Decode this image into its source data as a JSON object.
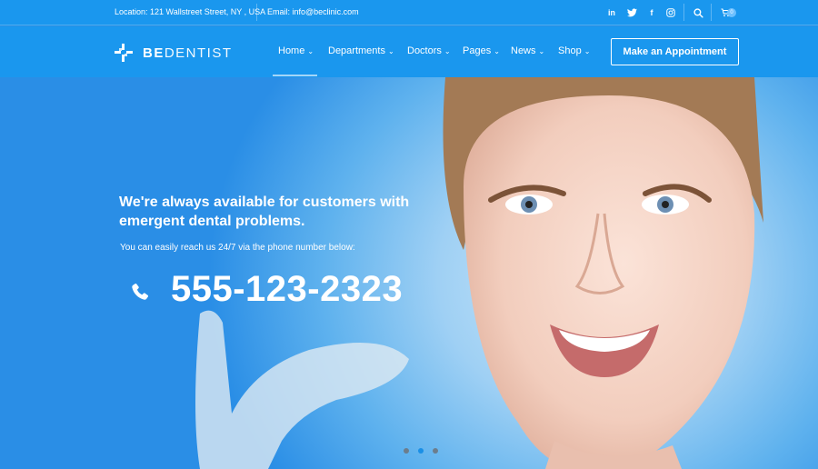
{
  "topbar": {
    "location": "Location: 121 Wallstreet Street, NY , USA",
    "email": "Email: info@beclinic.com",
    "social": [
      {
        "icon": "linkedin-icon",
        "glyph": "in"
      },
      {
        "icon": "twitter-icon",
        "glyph": "t"
      },
      {
        "icon": "facebook-icon",
        "glyph": "f"
      },
      {
        "icon": "instagram-icon",
        "glyph": "◎"
      }
    ],
    "cart_count": "0"
  },
  "brand": {
    "bold": "BE",
    "light": "DENTIST"
  },
  "nav": {
    "items": [
      {
        "label": "Home",
        "active": true
      },
      {
        "label": "Departments"
      },
      {
        "label": "Doctors"
      },
      {
        "label": "Pages"
      },
      {
        "label": "News"
      },
      {
        "label": "Shop"
      }
    ],
    "cta": "Make an Appointment"
  },
  "hero": {
    "headline": "We're always available for customers with emergent dental problems.",
    "subline": "You can easily reach us 24/7  via the phone number below:",
    "phone": "555-123-2323"
  },
  "slider": {
    "total": 3,
    "active": 2
  },
  "colors": {
    "bar": "#1a97ee",
    "accent": "#1a8fe6"
  }
}
